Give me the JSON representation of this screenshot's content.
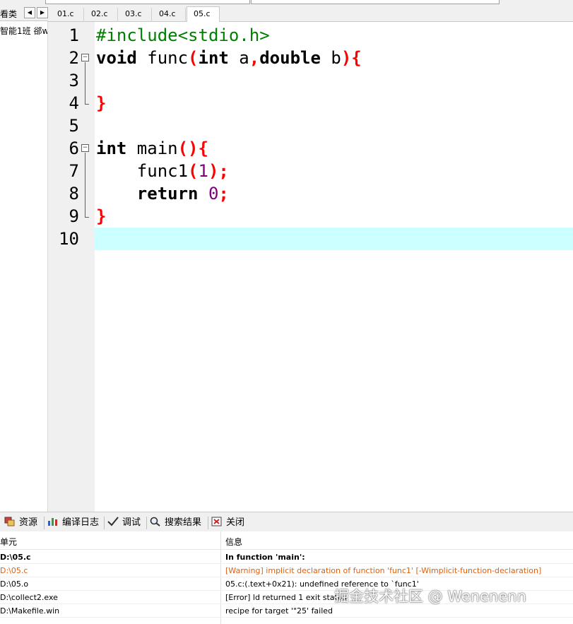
{
  "left_panel": {
    "tab_label": "看类",
    "tree_node": "智能1班 郤w"
  },
  "editor_tabs": [
    "01.c",
    "02.c",
    "03.c",
    "04.c",
    "05.c"
  ],
  "active_tab": "05.c",
  "editor": {
    "line_numbers": [
      "1",
      "2",
      "3",
      "4",
      "5",
      "6",
      "7",
      "8",
      "9",
      "10"
    ],
    "current_line": "10",
    "code": {
      "l1": "#include<stdio.h>",
      "l2_kw1": "void",
      "l2_name": " func",
      "l2_p1": "(",
      "l2_kw2": "int",
      "l2_a": " a",
      "l2_comma": ",",
      "l2_kw3": "double",
      "l2_b": " b",
      "l2_p2": "){",
      "l4_close": "}",
      "l6_kw": "int",
      "l6_name": " main",
      "l6_p": "(){",
      "l7_indent": "    func1",
      "l7_p1": "(",
      "l7_num": "1",
      "l7_p2": ");",
      "l8_indent": "    ",
      "l8_kw": "return",
      "l8_sp": " ",
      "l8_num": "0",
      "l8_semi": ";",
      "l9_close": "}"
    }
  },
  "bottom_tabs": {
    "resources": "资源",
    "compile_log": "编译日志",
    "debug": "调试",
    "search_results": "搜索结果",
    "close": "关闭"
  },
  "results": {
    "col_unit": "单元",
    "col_info": "信息",
    "rows": [
      {
        "unit": "D:\\05.c",
        "info": "In function 'main':"
      },
      {
        "unit": "D:\\05.c",
        "info": "[Warning] implicit declaration of function 'func1' [-Wimplicit-function-declaration]"
      },
      {
        "unit": "D:\\05.o",
        "info": "05.c:(.text+0x21): undefined reference to `func1'"
      },
      {
        "unit": "D:\\collect2.exe",
        "info": "[Error] ld returned 1 exit status"
      },
      {
        "unit": "D:\\Makefile.win",
        "info": "recipe for target '\"25' failed"
      }
    ]
  },
  "watermark": "掘金技术社区 @ Wenenenn",
  "colors": {
    "current_line": "#ccffff",
    "preprocessor": "#008000",
    "punctuation": "#ff0000",
    "number": "#800080",
    "warning": "#e06010"
  }
}
